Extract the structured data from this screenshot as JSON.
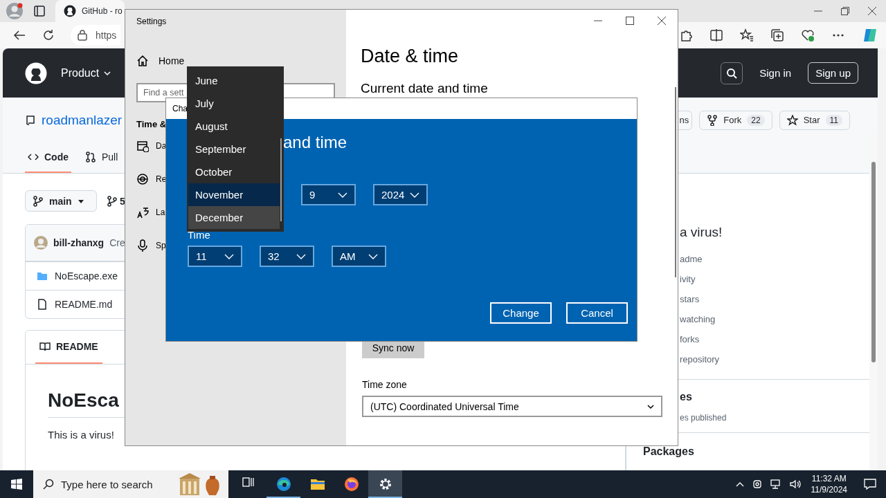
{
  "browser": {
    "tab_title": "GitHub - ro",
    "address": "https"
  },
  "github": {
    "nav": [
      "Product"
    ],
    "sign_in": "Sign in",
    "sign_up": "Sign up",
    "repo_name": "roadmanlazer",
    "repo_actions": [
      {
        "kind": "plain",
        "label": "ns"
      },
      {
        "kind": "fork",
        "label": "Fork",
        "count": "22"
      },
      {
        "kind": "star",
        "label": "Star",
        "count": "11"
      }
    ],
    "tabs": [
      {
        "kind": "code",
        "label": "Code",
        "selected": true
      },
      {
        "kind": "pull",
        "label": "Pull",
        "selected": false
      }
    ],
    "branch": "main",
    "branch_count": "5",
    "commit_author": "bill-zhanxg",
    "commit_message": "Cre",
    "files": [
      {
        "kind": "folder",
        "name": "NoEscape.exe"
      },
      {
        "kind": "file",
        "name": "README.md"
      }
    ],
    "readme_tab": "README",
    "readme_heading": "NoEsca",
    "readme_text": "This is a virus!",
    "about_text": "a virus!",
    "about_links": [
      "adme",
      "ivity",
      "stars",
      "watching",
      "forks",
      "repository"
    ],
    "releases_heading": "es",
    "releases_note": "es published",
    "packages_heading": "Packages"
  },
  "settings": {
    "title": "Settings",
    "home": "Home",
    "search_placeholder": "Find a sett",
    "section": "Time &",
    "nav": [
      {
        "kind": "date",
        "label": "Da"
      },
      {
        "kind": "region",
        "label": "Re"
      },
      {
        "kind": "language",
        "label": "La"
      },
      {
        "kind": "speech",
        "label": "Sp"
      }
    ],
    "heading": "Date & time",
    "subheading": "Current date and time",
    "sync_button": "Sync now",
    "time_zone_label": "Time zone",
    "time_zone": "(UTC) Coordinated Universal Time"
  },
  "dialog": {
    "title": "Cha",
    "heading": "and time",
    "date_fields": [
      "9",
      "2024"
    ],
    "time_label": "Time",
    "time_fields": [
      "11",
      "32",
      "AM"
    ],
    "buttons": [
      "Change",
      "Cancel"
    ]
  },
  "month_dropdown": {
    "items": [
      {
        "label": "June",
        "selected": false,
        "hovered": false
      },
      {
        "label": "July",
        "selected": false,
        "hovered": false
      },
      {
        "label": "August",
        "selected": false,
        "hovered": false
      },
      {
        "label": "September",
        "selected": false,
        "hovered": false
      },
      {
        "label": "October",
        "selected": false,
        "hovered": false
      },
      {
        "label": "November",
        "selected": true,
        "hovered": false
      },
      {
        "label": "December",
        "selected": false,
        "hovered": true
      }
    ]
  },
  "taskbar": {
    "search_placeholder": "Type here to search",
    "apps": [
      {
        "kind": "taskview",
        "running": false,
        "selected": false
      },
      {
        "kind": "edge",
        "running": true,
        "selected": false
      },
      {
        "kind": "explorer",
        "running": false,
        "selected": false
      },
      {
        "kind": "firefox",
        "running": false,
        "selected": false
      },
      {
        "kind": "settings",
        "running": true,
        "selected": true
      }
    ],
    "time": "11:32 AM",
    "date": "11/9/2024"
  }
}
